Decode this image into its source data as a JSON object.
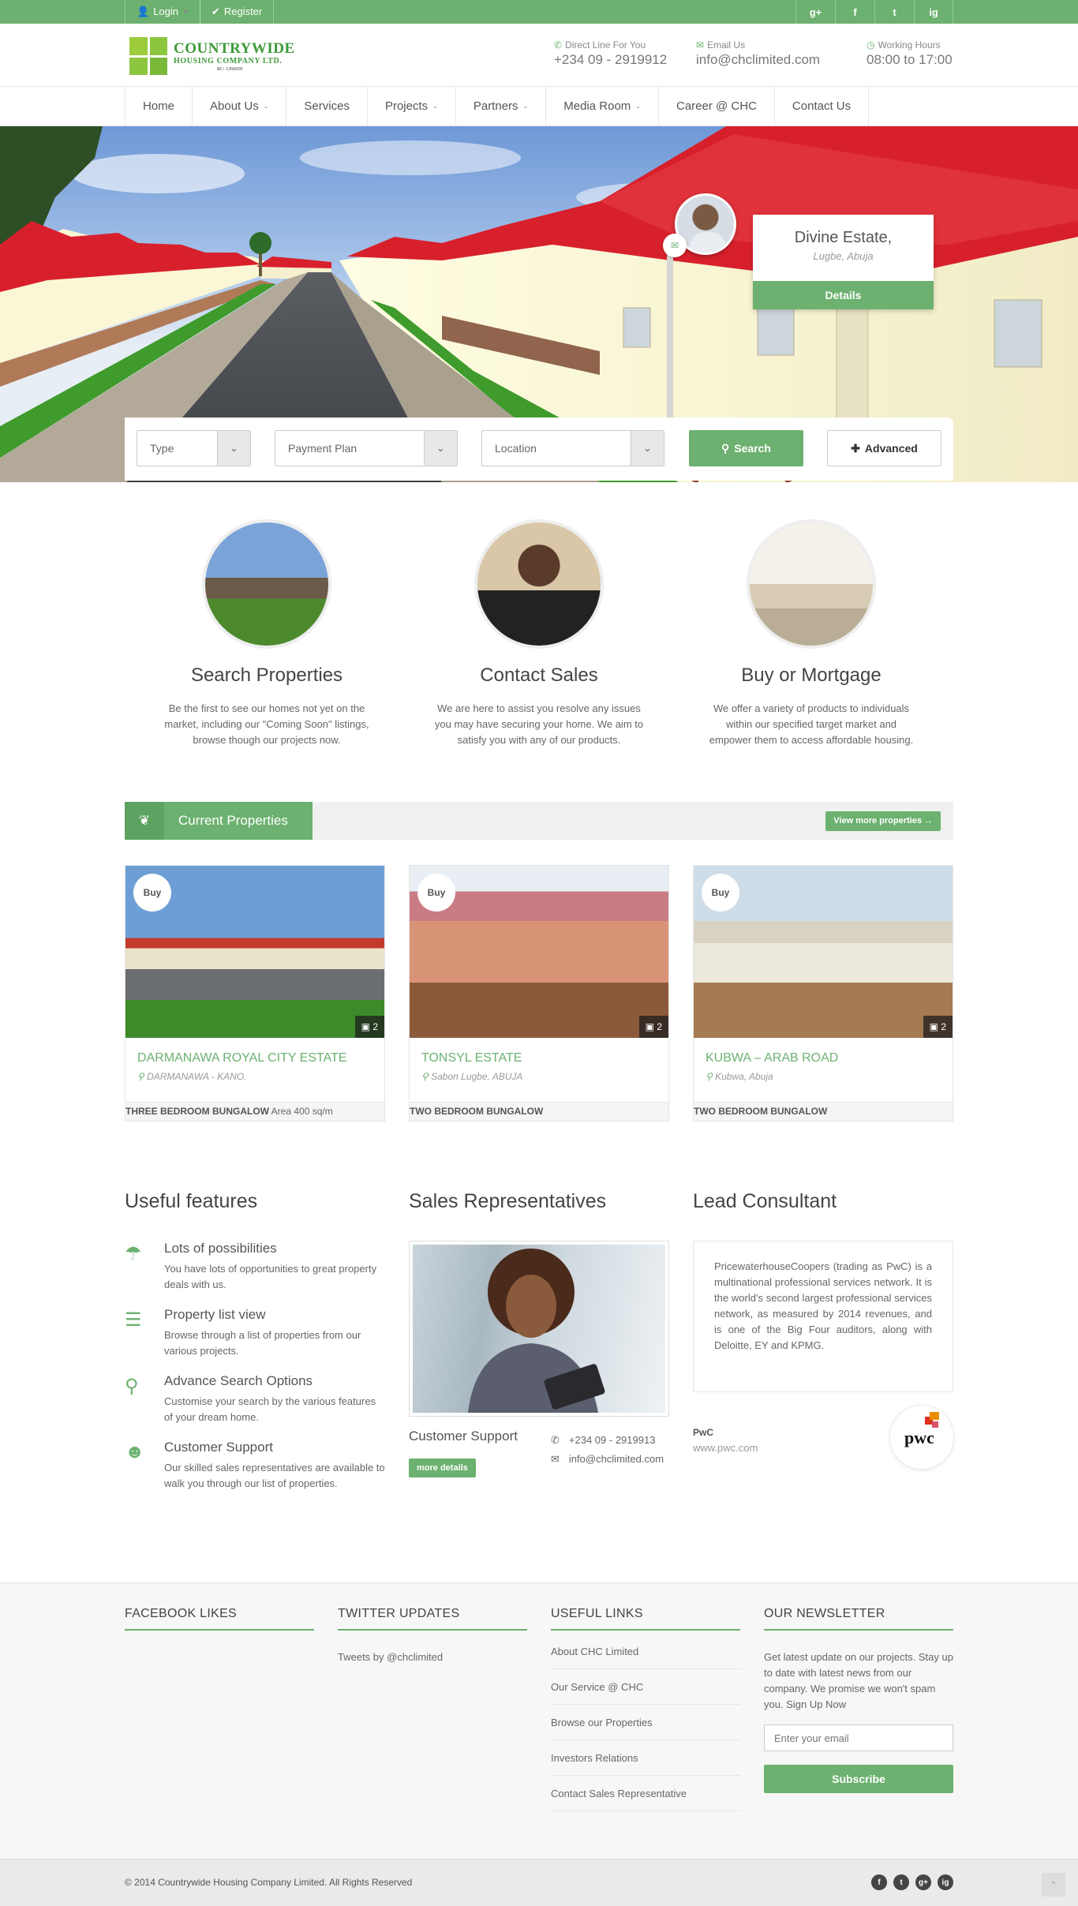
{
  "topbar": {
    "login": "Login",
    "register": "Register",
    "social": [
      "g+",
      "f",
      "t",
      "ig"
    ]
  },
  "logo": {
    "line1": "COUNTRYWIDE",
    "line2": "HOUSING COMPANY LTD.",
    "line3": "RC: 1266058"
  },
  "contact": {
    "phone_label": "Direct Line For You",
    "phone": "+234 09 - 2919912",
    "email_label": "Email Us",
    "email": "info@chclimited.com",
    "hours_label": "Working Hours",
    "hours": "08:00 to 17:00"
  },
  "nav": [
    "Home",
    "About Us",
    "Services",
    "Projects",
    "Partners",
    "Media Room",
    "Career @ CHC",
    "Contact Us"
  ],
  "nav_dropdown": [
    false,
    true,
    false,
    true,
    true,
    true,
    false,
    false
  ],
  "hero": {
    "estate_title": "Divine Estate,",
    "estate_sub": "Lugbe, Abuja",
    "details": "Details"
  },
  "search": {
    "type": "Type",
    "payment": "Payment Plan",
    "location": "Location",
    "search": "Search",
    "advanced": "Advanced"
  },
  "features": [
    {
      "title": "Search Properties",
      "text": "Be the first to see our homes not yet on the market, including our \"Coming Soon\" listings, browse though our projects now."
    },
    {
      "title": "Contact Sales",
      "text": "We are here to assist you resolve any issues you may have securing your home. We aim to satisfy you with any of our products."
    },
    {
      "title": "Buy or Mortgage",
      "text": "We offer a variety of products to individuals within our specified target market and empower them to access affordable housing."
    }
  ],
  "current": {
    "label": "Current Properties",
    "more": "View more properties"
  },
  "properties": [
    {
      "badge": "Buy",
      "count": "2",
      "title": "DARMANAWA ROYAL CITY ESTATE",
      "loc": "DARMANAWA - KANO.",
      "type": "THREE BEDROOM BUNGALOW",
      "extra": "Area 400 sq/m"
    },
    {
      "badge": "Buy",
      "count": "2",
      "title": "TONSYL ESTATE",
      "loc": "Sabon Lugbe, ABUJA",
      "type": "TWO BEDROOM BUNGALOW",
      "extra": ""
    },
    {
      "badge": "Buy",
      "count": "2",
      "title": "KUBWA – ARAB ROAD",
      "loc": "Kubwa, Abuja",
      "type": "TWO BEDROOM BUNGALOW",
      "extra": ""
    }
  ],
  "useful": {
    "heading": "Useful features",
    "items": [
      {
        "title": "Lots of possibilities",
        "text": "You have lots of opportunities to great property deals with us."
      },
      {
        "title": "Property list view",
        "text": "Browse through a list of properties from our various projects."
      },
      {
        "title": "Advance Search Options",
        "text": "Customise your search by the various features of your dream home."
      },
      {
        "title": "Customer Support",
        "text": "Our skilled sales representatives are available to walk you through our list of properties."
      }
    ]
  },
  "sales": {
    "heading": "Sales Representatives",
    "name": "Customer Support",
    "more": "more details",
    "phone": "+234 09 - 2919913",
    "email": "info@chclimited.com"
  },
  "lead": {
    "heading": "Lead Consultant",
    "quote": "PricewaterhouseCoopers (trading as PwC) is a multinational professional services network. It is the world's second largest professional services network, as measured by 2014 revenues, and is one of the Big Four auditors, along with Deloitte, EY and KPMG.",
    "company": "PwC",
    "url": "www.pwc.com",
    "logo_text": "pwc"
  },
  "footer": {
    "fb": "FACEBOOK LIKES",
    "tw": "TWITTER UPDATES",
    "tweets": "Tweets by @chclimited",
    "links_h": "USEFUL LINKS",
    "links": [
      "About CHC Limited",
      "Our Service @ CHC",
      "Browse our Properties",
      "Investors Relations",
      "Contact Sales Representative"
    ],
    "news_h": "OUR NEWSLETTER",
    "news_text": "Get latest update on our projects. Stay up to date with latest news from our company. We promise we won't spam you. Sign Up Now",
    "email_ph": "Enter your email",
    "subscribe": "Subscribe"
  },
  "bottom": {
    "copyright": "© 2014 Countrywide Housing Company Limited. All Rights Reserved",
    "social": [
      "f",
      "t",
      "g+",
      "ig"
    ]
  },
  "colors": {
    "accent": "#6cb16f"
  }
}
